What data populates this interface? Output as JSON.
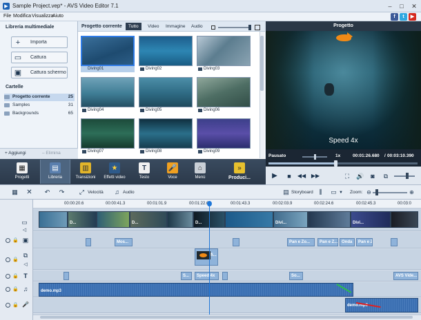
{
  "window": {
    "title": "Sample Project.vep* - AVS Video Editor 7.1"
  },
  "menu": {
    "items": [
      "File",
      "Modifica",
      "Visualizza",
      "Aiuto"
    ]
  },
  "social": [
    "f",
    "t",
    "▶"
  ],
  "library": {
    "title": "Libreria multimediale",
    "buttons": [
      "Importa",
      "Cattura",
      "Cattura schermo"
    ],
    "folders_title": "Cartelle",
    "folders": [
      {
        "name": "Progetto corrente",
        "count": "25"
      },
      {
        "name": "Samples",
        "count": "31"
      },
      {
        "name": "Backgrounds",
        "count": "65"
      }
    ],
    "add_label": "Aggiungi",
    "delete_label": "Elimina"
  },
  "project": {
    "title": "Progetto corrente",
    "tabs": [
      "Tutto",
      "Video",
      "Immagine",
      "Audio"
    ],
    "clips": [
      "Diving01",
      "Diving02",
      "Diving03",
      "Diving04",
      "Diving05",
      "Diving06",
      "Diving07",
      "Diving08",
      "Diving09"
    ]
  },
  "preview": {
    "title": "Progetto",
    "overlay_text": "Speed 4x",
    "status": "Pausato",
    "speed": "1x",
    "time_current": "00:01:26.680",
    "time_total": "00:03:10.390"
  },
  "toolbar": {
    "items": [
      "Progetti",
      "Libreria",
      "Transizioni",
      "Effetti video",
      "Testo",
      "Voce",
      "Menù",
      "Produci..."
    ]
  },
  "timeline": {
    "velocita": "Velocità",
    "audio": "Audio",
    "storyboard": "Storyboard",
    "zoom": "Zoom:",
    "ruler": [
      "00:00:20.6",
      "00:00:41.3",
      "00:01:01.9",
      "00:01:22.6",
      "00:01:43.3",
      "00:02:03.9",
      "00:02:24.6",
      "00:02:45.3",
      "00:03:0"
    ],
    "effects": [
      "Mos...",
      "Pan e Zo...",
      "Pan e Z...",
      "Onda",
      "Pan e Zo..."
    ],
    "overlay_clip": "fi...",
    "text_clips": [
      "S...",
      "Speed 4x",
      "So...",
      "AVS Vide..."
    ],
    "audio1": "demo.mp3",
    "audio2": "demo.mp3",
    "video_labels": [
      "D...",
      "D...",
      "D...",
      "Divi...",
      "Divi..."
    ]
  }
}
